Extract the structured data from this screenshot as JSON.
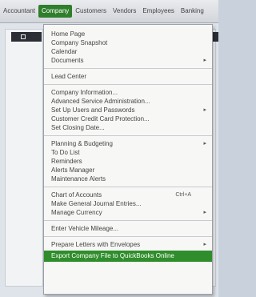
{
  "menubar": {
    "items": [
      {
        "label": "Accountant"
      },
      {
        "label": "Company"
      },
      {
        "label": "Customers"
      },
      {
        "label": "Vendors"
      },
      {
        "label": "Employees"
      },
      {
        "label": "Banking"
      }
    ]
  },
  "company_menu": {
    "group1": [
      {
        "label": "Home Page"
      },
      {
        "label": "Company Snapshot"
      },
      {
        "label": "Calendar"
      },
      {
        "label": "Documents",
        "submenu": true
      }
    ],
    "group2": [
      {
        "label": "Lead Center"
      }
    ],
    "group3": [
      {
        "label": "Company Information..."
      },
      {
        "label": "Advanced Service Administration..."
      },
      {
        "label": "Set Up Users and Passwords",
        "submenu": true
      },
      {
        "label": "Customer Credit Card Protection..."
      },
      {
        "label": "Set Closing Date..."
      }
    ],
    "group4": [
      {
        "label": "Planning & Budgeting",
        "submenu": true
      },
      {
        "label": "To Do List"
      },
      {
        "label": "Reminders"
      },
      {
        "label": "Alerts Manager"
      },
      {
        "label": "Maintenance Alerts"
      }
    ],
    "group5": [
      {
        "label": "Chart of Accounts",
        "shortcut": "Ctrl+A"
      },
      {
        "label": "Make General Journal Entries..."
      },
      {
        "label": "Manage Currency",
        "submenu": true
      }
    ],
    "group6": [
      {
        "label": "Enter Vehicle Mileage..."
      }
    ],
    "group7": [
      {
        "label": "Prepare Letters with Envelopes",
        "submenu": true
      }
    ],
    "highlighted": {
      "label": "Export Company File to QuickBooks Online"
    }
  }
}
